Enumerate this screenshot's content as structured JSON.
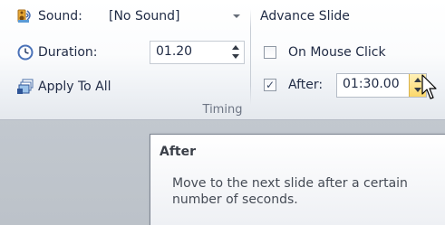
{
  "timing_group": {
    "label": "Timing",
    "sound": {
      "label": "Sound:",
      "value": "[No Sound]",
      "icon": "speaker-icon"
    },
    "duration": {
      "label": "Duration:",
      "value": "01.20",
      "icon": "clock-icon"
    },
    "apply_to_all": {
      "label": "Apply To All",
      "icon": "apply-to-all-icon"
    },
    "advance_slide": {
      "heading": "Advance Slide",
      "on_mouse_click": {
        "label": "On Mouse Click",
        "checked": false
      },
      "after": {
        "label": "After:",
        "checked": true,
        "value": "01:30.00"
      }
    }
  },
  "tooltip": {
    "title": "After",
    "body": "Move to the next slide after a certain number of seconds."
  },
  "colors": {
    "spin_hover": "#fbe38a",
    "text": "#1f2a44"
  }
}
